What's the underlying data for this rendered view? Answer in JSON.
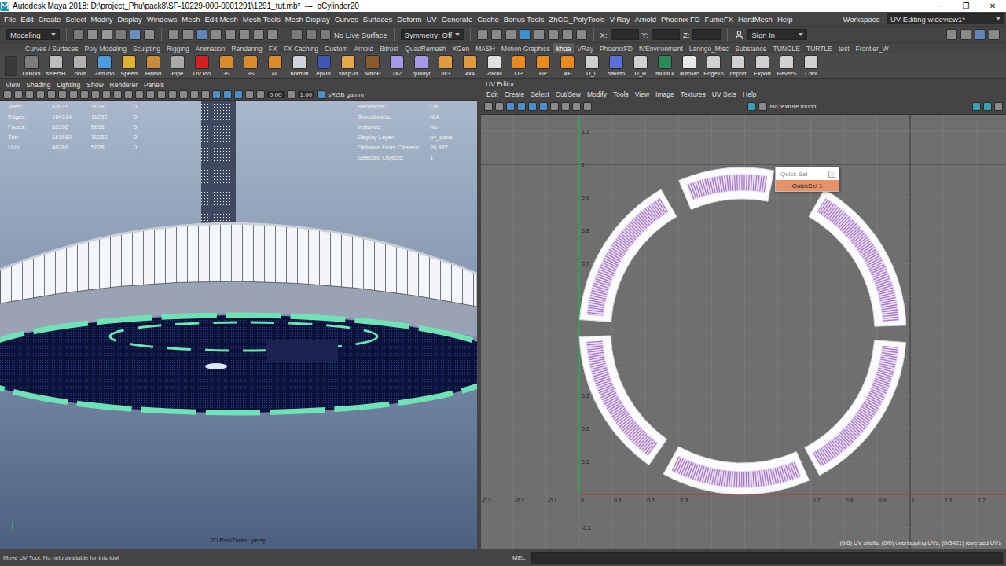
{
  "window": {
    "title": "Autodesk Maya 2018: D:\\project_Phu\\pack8\\SF-10229-000-0001291\\1291_tut.mb*  ---  pCylinder20",
    "controls": [
      "─",
      "❐",
      "✕"
    ]
  },
  "menu": [
    "File",
    "Edit",
    "Create",
    "Select",
    "Modify",
    "Display",
    "Windows",
    "Mesh",
    "Edit Mesh",
    "Mesh Tools",
    "Mesh Display",
    "Curves",
    "Surfaces",
    "Deform",
    "UV",
    "Generate",
    "Cache",
    "Bonus Tools",
    "ZhCG_PolyTools",
    "V-Ray",
    "Arnold",
    "Phoenix FD",
    "FumeFX",
    "HardMesh",
    "Help"
  ],
  "workspace": {
    "label": "Workspace :",
    "value": "UV Editing wideview1*"
  },
  "status_line": {
    "mode": "Modeling",
    "live_surface": "No Live Surface",
    "symmetry": "Symmetry: Off",
    "fields": [
      "X:",
      "Y:",
      "Z:"
    ],
    "sign_in": "Sign In"
  },
  "shelf_tabs": [
    {
      "label": "Curves / Surfaces",
      "selected": false
    },
    {
      "label": "Poly Modeling",
      "selected": false
    },
    {
      "label": "Sculpting",
      "selected": false
    },
    {
      "label": "Rigging",
      "selected": false
    },
    {
      "label": "Animation",
      "selected": false
    },
    {
      "label": "Rendering",
      "selected": false
    },
    {
      "label": "FX",
      "selected": false
    },
    {
      "label": "FX Caching",
      "selected": false
    },
    {
      "label": "Custom",
      "selected": false
    },
    {
      "label": "Arnold",
      "selected": false
    },
    {
      "label": "Bifrost",
      "selected": false
    },
    {
      "label": "QuadRemesh",
      "selected": false
    },
    {
      "label": "XGen",
      "selected": false
    },
    {
      "label": "MASH",
      "selected": false
    },
    {
      "label": "Motion Graphics",
      "selected": false
    },
    {
      "label": "khoa",
      "selected": true
    },
    {
      "label": "VRay",
      "selected": false
    },
    {
      "label": "PhoenixFD",
      "selected": false
    },
    {
      "label": "fVEnvironment",
      "selected": false
    },
    {
      "label": "Lanngo_Misc",
      "selected": false
    },
    {
      "label": "Substance",
      "selected": false
    },
    {
      "label": "TUNGLE",
      "selected": false
    },
    {
      "label": "TURTLE",
      "selected": false
    },
    {
      "label": "test",
      "selected": false
    },
    {
      "label": "Frontier_W",
      "selected": false
    }
  ],
  "shelf": [
    {
      "label": "DrBool",
      "color": "#7d7d7d"
    },
    {
      "label": "selectH",
      "color": "#bdbdbd"
    },
    {
      "label": "orvit",
      "color": "#b0b0b0"
    },
    {
      "label": "ZenToo",
      "color": "#4f9be0"
    },
    {
      "label": "Speed",
      "color": "#e0b030"
    },
    {
      "label": "Bweld",
      "color": "#c98a3a"
    },
    {
      "label": "Pipe",
      "color": "#a9a9a9"
    },
    {
      "label": "UVToo",
      "color": "#d32020"
    },
    {
      "label": "3S",
      "color": "#d98b2b"
    },
    {
      "label": "3S",
      "color": "#d98b2b"
    },
    {
      "label": "4L",
      "color": "#d98b2b"
    },
    {
      "label": "normal",
      "color": "#cfd3da"
    },
    {
      "label": "epUV",
      "color": "#3d58b8"
    },
    {
      "label": "snap2d",
      "color": "#e3a84a"
    },
    {
      "label": "NitroP",
      "color": "#8a5a30"
    },
    {
      "label": "2x2",
      "color": "#a898e8"
    },
    {
      "label": "quadyf",
      "color": "#a898e8"
    },
    {
      "label": "3x3",
      "color": "#e09a40"
    },
    {
      "label": "4x4",
      "color": "#e09a40"
    },
    {
      "label": "ZiRail",
      "color": "#e0e0e0"
    },
    {
      "label": "OP",
      "color": "#e88a20"
    },
    {
      "label": "BP",
      "color": "#e88a20"
    },
    {
      "label": "AF",
      "color": "#e88a20"
    },
    {
      "label": "D_L",
      "color": "#cfcfcf"
    },
    {
      "label": "baketo",
      "color": "#5a6fd8"
    },
    {
      "label": "D_R",
      "color": "#cfcfcf"
    },
    {
      "label": "multiOl",
      "color": "#2a8a5a"
    },
    {
      "label": "autoMc",
      "color": "#e8e8e8"
    },
    {
      "label": "EdgeTo",
      "color": "#d0d0d0"
    },
    {
      "label": "Import",
      "color": "#d0d0d0"
    },
    {
      "label": "Export",
      "color": "#d0d0d0"
    },
    {
      "label": "ReverS",
      "color": "#d0d0d0"
    },
    {
      "label": "Cabl",
      "color": "#d0d0d0"
    }
  ],
  "viewport": {
    "menu": [
      "View",
      "Shading",
      "Lighting",
      "Show",
      "Renderer",
      "Panels"
    ],
    "exposure": "0.00",
    "gamma": "1.00",
    "color_space": "sRGB gamm",
    "stats": [
      {
        "label": "Verts:",
        "values": [
          "82079",
          "5628",
          "0"
        ]
      },
      {
        "label": "Edges:",
        "values": [
          "164314",
          "11232",
          "0"
        ]
      },
      {
        "label": "Faces:",
        "values": [
          "82388",
          "5616",
          "0"
        ]
      },
      {
        "label": "Tris:",
        "values": [
          "161580",
          "11232",
          "0"
        ]
      },
      {
        "label": "UVs:",
        "values": [
          "40268",
          "5628",
          "0"
        ]
      }
    ],
    "info": [
      {
        "label": "Backfaces:",
        "value": "Off"
      },
      {
        "label": "Smoothness:",
        "value": "N/A"
      },
      {
        "label": "Instance:",
        "value": "No"
      },
      {
        "label": "Display Layer:",
        "value": "uv_done"
      },
      {
        "label": "Distance From Camera:",
        "value": "26.887"
      },
      {
        "label": "Selected Objects:",
        "value": "1"
      }
    ],
    "camera_label": "2D Pan/Zoom : persp"
  },
  "uv_editor": {
    "title": "UV Editor",
    "menu": [
      "Edit",
      "Create",
      "Select",
      "Cut/Sew",
      "Modify",
      "Tools",
      "View",
      "Image",
      "Textures",
      "UV Sets",
      "Help"
    ],
    "texture_status": "No texture found",
    "v_ticks": [
      "1.1",
      "1",
      "0.9",
      "0.8",
      "0.7",
      "0.3",
      "0.2",
      "0.1",
      "-0.1"
    ],
    "u_ticks": [
      "-0.3",
      "-0.2",
      "-0.1",
      "0",
      "0.1",
      "0.2",
      "0.3",
      "0.7",
      "0.8",
      "0.9",
      "1",
      "1.1",
      "1.2"
    ],
    "status": "(0/6) UV shells, (0/0) overlapping UVs, (0/3421) reversed UVs",
    "quick_sel": {
      "title": "Quick Sel",
      "items": [
        {
          "label": "QuickSel 1",
          "selected": true
        }
      ]
    }
  },
  "help_line": {
    "text": "Move UV Tool: No help available for this tool",
    "mel": "MEL"
  }
}
